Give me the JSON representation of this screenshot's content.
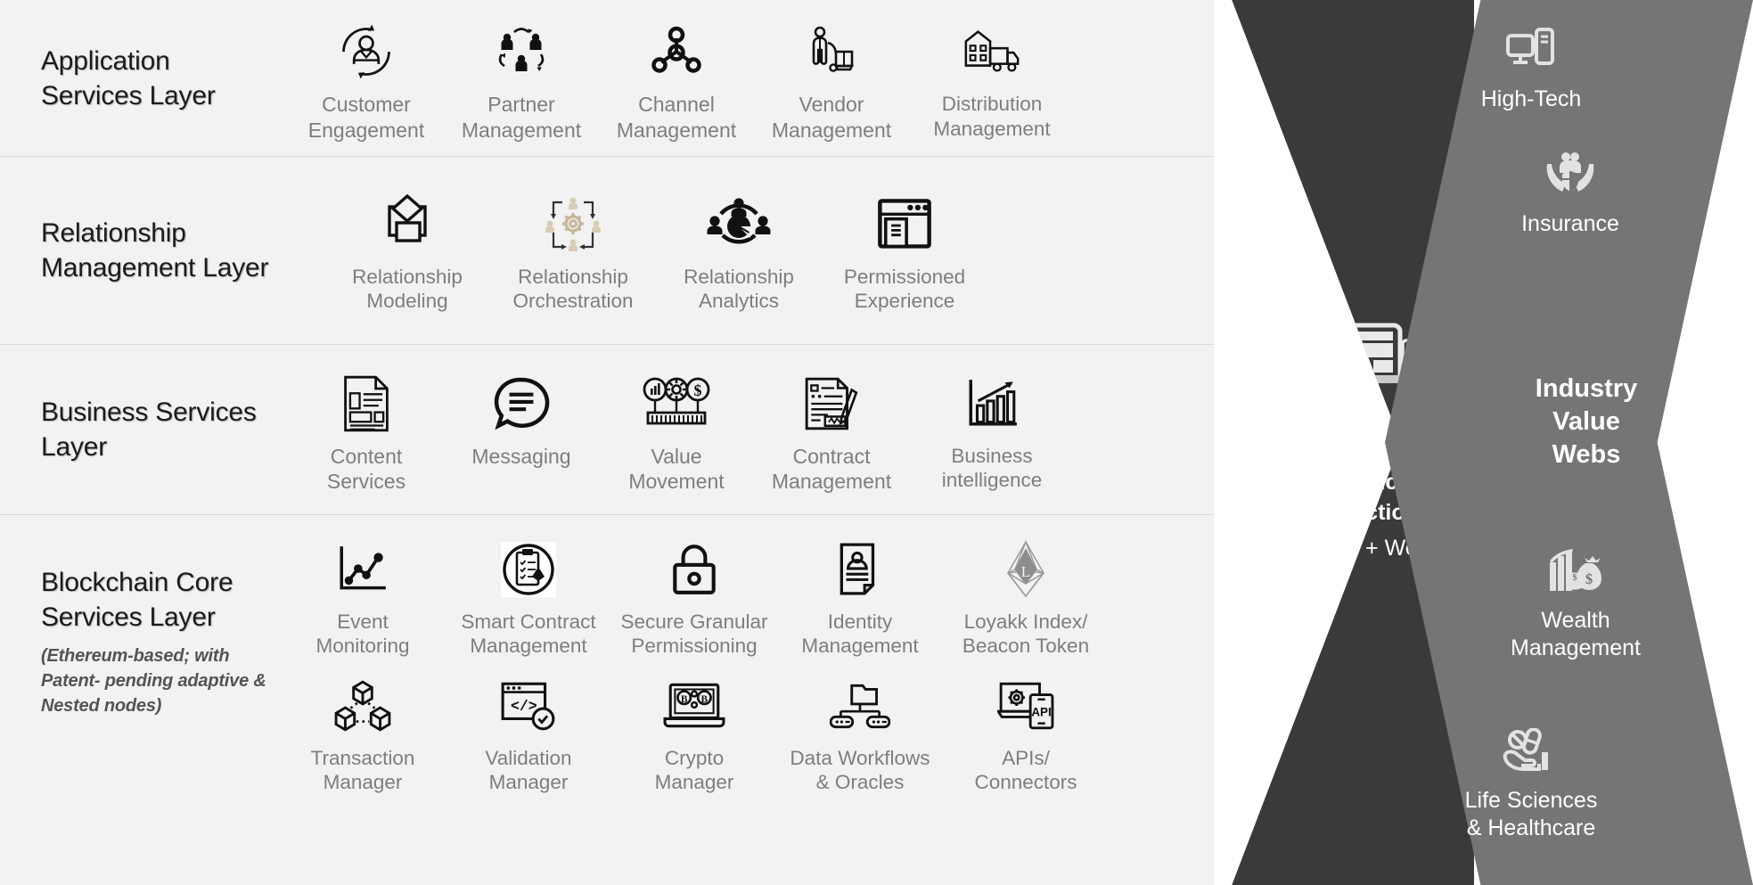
{
  "layers": [
    {
      "id": "application-services",
      "title": "Application\nServices Layer",
      "items": [
        {
          "label": "Customer\nEngagement",
          "icon": "customer-engagement-icon"
        },
        {
          "label": "Partner\nManagement",
          "icon": "partner-management-icon"
        },
        {
          "label": "Channel\nManagement",
          "icon": "channel-management-icon"
        },
        {
          "label": "Vendor\nManagement",
          "icon": "vendor-management-icon"
        },
        {
          "label": "Distribution\nManagement",
          "icon": "distribution-management-icon"
        }
      ]
    },
    {
      "id": "relationship-management",
      "title": "Relationship\nManagement\nLayer",
      "items": [
        {
          "label": "Relationship\nModeling",
          "icon": "relationship-modeling-icon"
        },
        {
          "label": "Relationship\nOrchestration",
          "icon": "relationship-orchestration-icon"
        },
        {
          "label": "Relationship\nAnalytics",
          "icon": "relationship-analytics-icon"
        },
        {
          "label": "Permissioned\nExperience",
          "icon": "permissioned-experience-icon"
        }
      ]
    },
    {
      "id": "business-services",
      "title": "Business\nServices Layer",
      "items": [
        {
          "label": "Content\nServices",
          "icon": "content-services-icon"
        },
        {
          "label": "Messaging",
          "icon": "messaging-icon"
        },
        {
          "label": "Value\nMovement",
          "icon": "value-movement-icon"
        },
        {
          "label": "Contract\nManagement",
          "icon": "contract-management-icon"
        },
        {
          "label": "Business\nintelligence",
          "icon": "business-intelligence-icon"
        }
      ]
    },
    {
      "id": "blockchain-core-services",
      "title": "Blockchain\nCore Services\nLayer",
      "subtitle": "(Ethereum-based;\nwith Patent-\npending adaptive &\nNested nodes)",
      "items_row1": [
        {
          "label": "Event\nMonitoring",
          "icon": "event-monitoring-icon"
        },
        {
          "label": "Smart Contract\nManagement",
          "icon": "smart-contract-management-icon"
        },
        {
          "label": "Secure Granular\nPermissioning",
          "icon": "secure-granular-permissioning-icon"
        },
        {
          "label": "Identity\nManagement",
          "icon": "identity-management-icon"
        },
        {
          "label": "Loyakk Index/\nBeacon Token",
          "icon": "loyakk-index-beacon-token-icon"
        }
      ],
      "items_row2": [
        {
          "label": "Transaction\nManager",
          "icon": "transaction-manager-icon"
        },
        {
          "label": "Validation\nManager",
          "icon": "validation-manager-icon"
        },
        {
          "label": "Crypto\nManager",
          "icon": "crypto-manager-icon"
        },
        {
          "label": "Data Workflows\n& Oracles",
          "icon": "data-workflows-oracles-icon"
        },
        {
          "label": "APIs/\nConnectors",
          "icon": "apis-connectors-icon"
        }
      ]
    }
  ],
  "dark_panel": {
    "icon": "multi-device-icon",
    "title": "Personalized\nExperience &\nInteraction",
    "note": "(Mobile + Web)"
  },
  "gray_panel": {
    "title": "Industry\nValue\nWebs",
    "industries": [
      {
        "label": "High-Tech",
        "icon": "desktop-computer-icon"
      },
      {
        "label": "Insurance",
        "icon": "hands-shield-family-icon"
      },
      {
        "label": "Wealth\nManagement",
        "icon": "money-bag-chart-icon"
      },
      {
        "label": "Life Sciences\n& Healthcare",
        "icon": "hand-pills-icon"
      }
    ]
  },
  "colors": {
    "panel_background": "#f1f2f1",
    "dark_chevron": "#3a3a3a",
    "gray_chevron": "#757575",
    "layer_title": "#1b1b1b",
    "caption": "#7e7e7e",
    "accent_tan": "#d5c9b4"
  }
}
